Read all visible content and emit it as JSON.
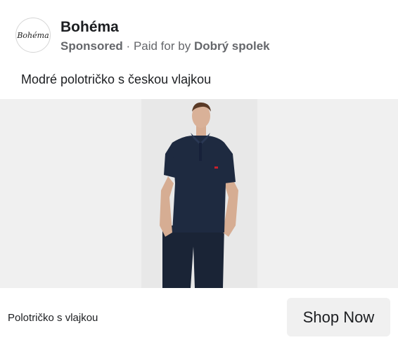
{
  "advertiser": {
    "logo_text": "Bohéma",
    "name": "Bohéma",
    "sponsored_label": "Sponsored",
    "separator": "·",
    "paid_for_prefix": "Paid for by",
    "paid_for_by": "Dobrý spolek"
  },
  "post": {
    "caption": "Modré polotričko s českou vlajkou"
  },
  "media": {
    "description": "man-wearing-navy-polo-shirt"
  },
  "footer": {
    "product_title": "Polotričko s vlajkou",
    "cta_label": "Shop Now"
  },
  "colors": {
    "shirt": "#1e2a40",
    "background": "#f0f0f0",
    "meta_text": "#65676b"
  }
}
